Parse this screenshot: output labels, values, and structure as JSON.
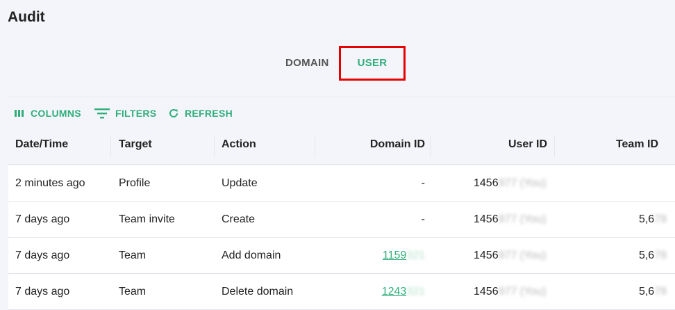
{
  "page": {
    "title": "Audit"
  },
  "tabs": [
    {
      "label": "DOMAIN",
      "selected": false
    },
    {
      "label": "USER",
      "selected": true
    }
  ],
  "toolbar": {
    "columns_label": "COLUMNS",
    "filters_label": "FILTERS",
    "refresh_label": "REFRESH"
  },
  "table": {
    "columns": [
      "Date/Time",
      "Target",
      "Action",
      "Domain ID",
      "User ID",
      "Team ID"
    ],
    "rows": [
      {
        "datetime": "2 minutes ago",
        "target": "Profile",
        "action": "Update",
        "domain_id": "-",
        "user_id": "1456",
        "user_id_redacted": "977 (You)",
        "team_id": "",
        "team_id_redacted": ""
      },
      {
        "datetime": "7 days ago",
        "target": "Team invite",
        "action": "Create",
        "domain_id": "-",
        "user_id": "1456",
        "user_id_redacted": "977 (You)",
        "team_id": "5,6",
        "team_id_redacted": "78"
      },
      {
        "datetime": "7 days ago",
        "target": "Team",
        "action": "Add domain",
        "domain_id": "1159",
        "domain_id_redacted": "321",
        "user_id": "1456",
        "user_id_redacted": "977 (You)",
        "team_id": "5,6",
        "team_id_redacted": "78"
      },
      {
        "datetime": "7 days ago",
        "target": "Team",
        "action": "Delete domain",
        "domain_id": "1243",
        "domain_id_redacted": "321",
        "user_id": "1456",
        "user_id_redacted": "977 (You)",
        "team_id": "5,6",
        "team_id_redacted": "78"
      }
    ]
  },
  "colors": {
    "accent": "#2fae7a",
    "highlight": "#e60000"
  }
}
